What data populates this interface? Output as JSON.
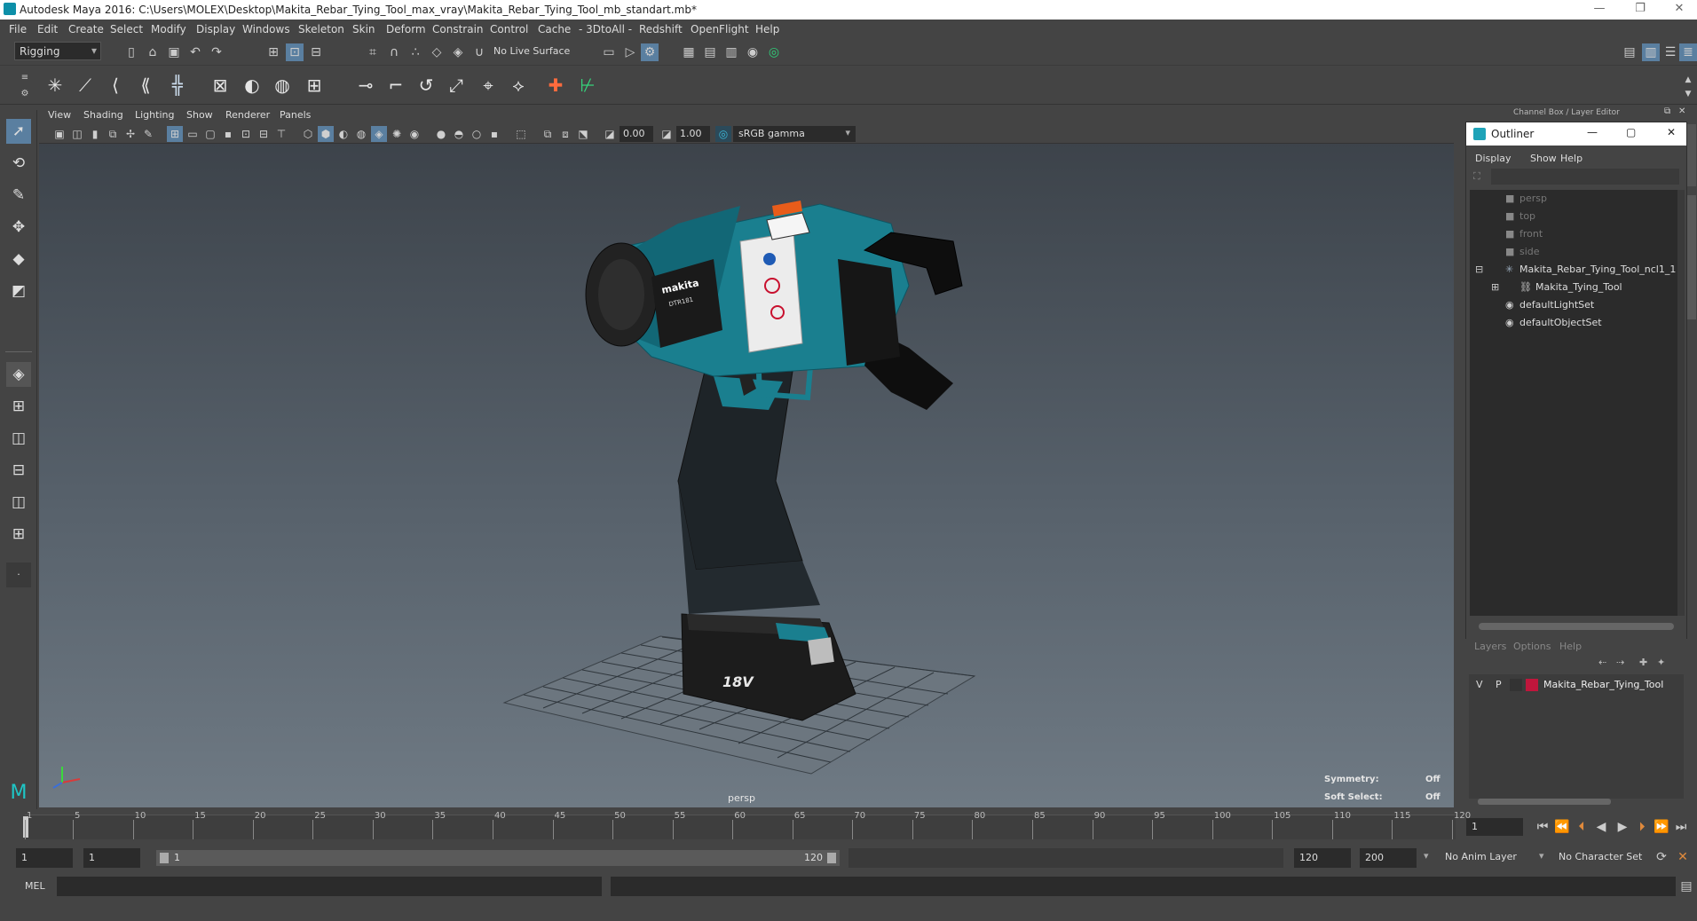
{
  "window": {
    "title": "Autodesk Maya 2016: C:\\Users\\MOLEX\\Desktop\\Makita_Rebar_Tying_Tool_max_vray\\Makita_Rebar_Tying_Tool_mb_standart.mb*",
    "minimize": "—",
    "restore": "❐",
    "close": "✕"
  },
  "menu": [
    "File",
    "Edit",
    "Create",
    "Select",
    "Modify",
    "Display",
    "Windows",
    "Skeleton",
    "Skin",
    "Deform",
    "Constrain",
    "Control",
    "Cache",
    "- 3DtoAll -",
    "Redshift",
    "OpenFlight",
    "Help"
  ],
  "status_line": {
    "menu_set": "Rigging",
    "live_surface": "No Live Surface"
  },
  "panel_menu": [
    "View",
    "Shading",
    "Lighting",
    "Show",
    "Renderer",
    "Panels"
  ],
  "panel_tools": {
    "exposure": "0.00",
    "gamma": "1.00",
    "color_space": "sRGB gamma"
  },
  "viewport": {
    "camera": "persp",
    "symmetry_label": "Symmetry:",
    "symmetry_value": "Off",
    "soft_select_label": "Soft Select:",
    "soft_select_value": "Off",
    "model_brand": "makita",
    "model_code": "DTR181",
    "model_voltage": "18V"
  },
  "channel_box": {
    "header": "Channel Box / Layer Editor"
  },
  "outliner": {
    "title": "Outliner",
    "menu": [
      "Display",
      "Show",
      "Help"
    ],
    "items": [
      {
        "label": "persp",
        "dim": true,
        "indent": 0
      },
      {
        "label": "top",
        "dim": true,
        "indent": 0
      },
      {
        "label": "front",
        "dim": true,
        "indent": 0
      },
      {
        "label": "side",
        "dim": true,
        "indent": 0
      },
      {
        "label": "Makita_Rebar_Tying_Tool_ncl1_1",
        "dim": false,
        "indent": 0
      },
      {
        "label": "Makita_Tying_Tool",
        "dim": false,
        "indent": 1
      },
      {
        "label": "defaultLightSet",
        "dim": false,
        "indent": 0
      },
      {
        "label": "defaultObjectSet",
        "dim": false,
        "indent": 0
      }
    ]
  },
  "layer_editor": {
    "menu": [
      "Layers",
      "Options",
      "Help"
    ],
    "layer_v": "V",
    "layer_p": "P",
    "layer_name": "Makita_Rebar_Tying_Tool",
    "layer_color": "#c0163c"
  },
  "timeline": {
    "ticks": [
      "1",
      "5",
      "10",
      "15",
      "20",
      "25",
      "30",
      "35",
      "40",
      "45",
      "50",
      "55",
      "60",
      "65",
      "70",
      "75",
      "80",
      "85",
      "90",
      "95",
      "100",
      "105",
      "110",
      "115",
      "120"
    ],
    "current_frame": "1"
  },
  "range": {
    "start": "1",
    "playback_start": "1",
    "slider_start": "1",
    "slider_end": "120",
    "playback_end": "120",
    "end": "200",
    "anim_layer": "No Anim Layer",
    "character_set": "No Character Set"
  },
  "command": {
    "language": "MEL"
  },
  "colors": {
    "accent": "#3cb8d8",
    "tool_teal": "#1a7f8f",
    "active_icon": "#5aa9d6"
  }
}
